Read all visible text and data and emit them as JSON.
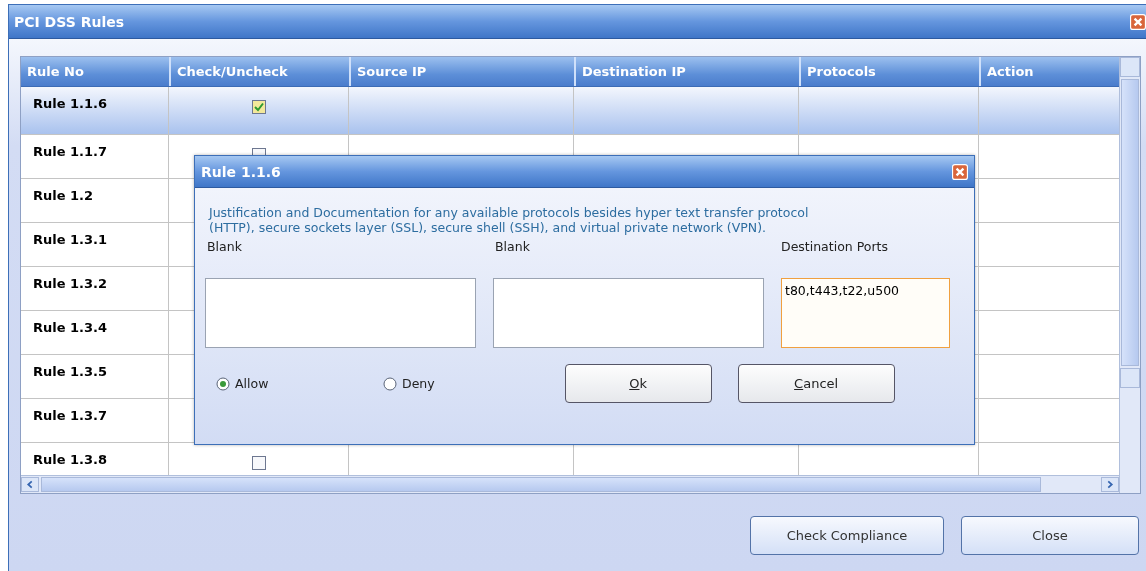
{
  "window": {
    "title": "PCI DSS Rules"
  },
  "table": {
    "columns": [
      "Rule No",
      "Check/Uncheck",
      "Source IP",
      "Destination IP",
      "Protocols",
      "Action"
    ],
    "rows": [
      {
        "rule": "Rule 1.1.6",
        "checked": true,
        "selected": true
      },
      {
        "rule": "Rule 1.1.7",
        "checked": false,
        "selected": false
      },
      {
        "rule": "Rule 1.2",
        "selected": false
      },
      {
        "rule": "Rule 1.3.1",
        "selected": false
      },
      {
        "rule": "Rule 1.3.2",
        "selected": false
      },
      {
        "rule": "Rule 1.3.4",
        "selected": false
      },
      {
        "rule": "Rule 1.3.5",
        "selected": false
      },
      {
        "rule": "Rule 1.3.7",
        "selected": false
      },
      {
        "rule": "Rule 1.3.8",
        "checked": false,
        "selected": false
      }
    ]
  },
  "dialog": {
    "title": "Rule 1.1.6",
    "description": "Justification and Documentation for any available protocols besides hyper text transfer protocol (HTTP), secure sockets layer (SSL), secure shell (SSH), and virtual private network (VPN).",
    "fields": [
      {
        "label": "Blank",
        "focused": false
      },
      {
        "label": "Blank",
        "focused": false
      },
      {
        "label": "Destination Ports",
        "value": "t80,t443,t22,u500",
        "focused": true
      }
    ],
    "options": [
      {
        "label": "Allow",
        "selected": true
      },
      {
        "label": "Deny",
        "selected": false
      }
    ],
    "buttons": [
      "Ok",
      "Cancel"
    ]
  },
  "footer_buttons": [
    "Check Compliance",
    "Close"
  ]
}
